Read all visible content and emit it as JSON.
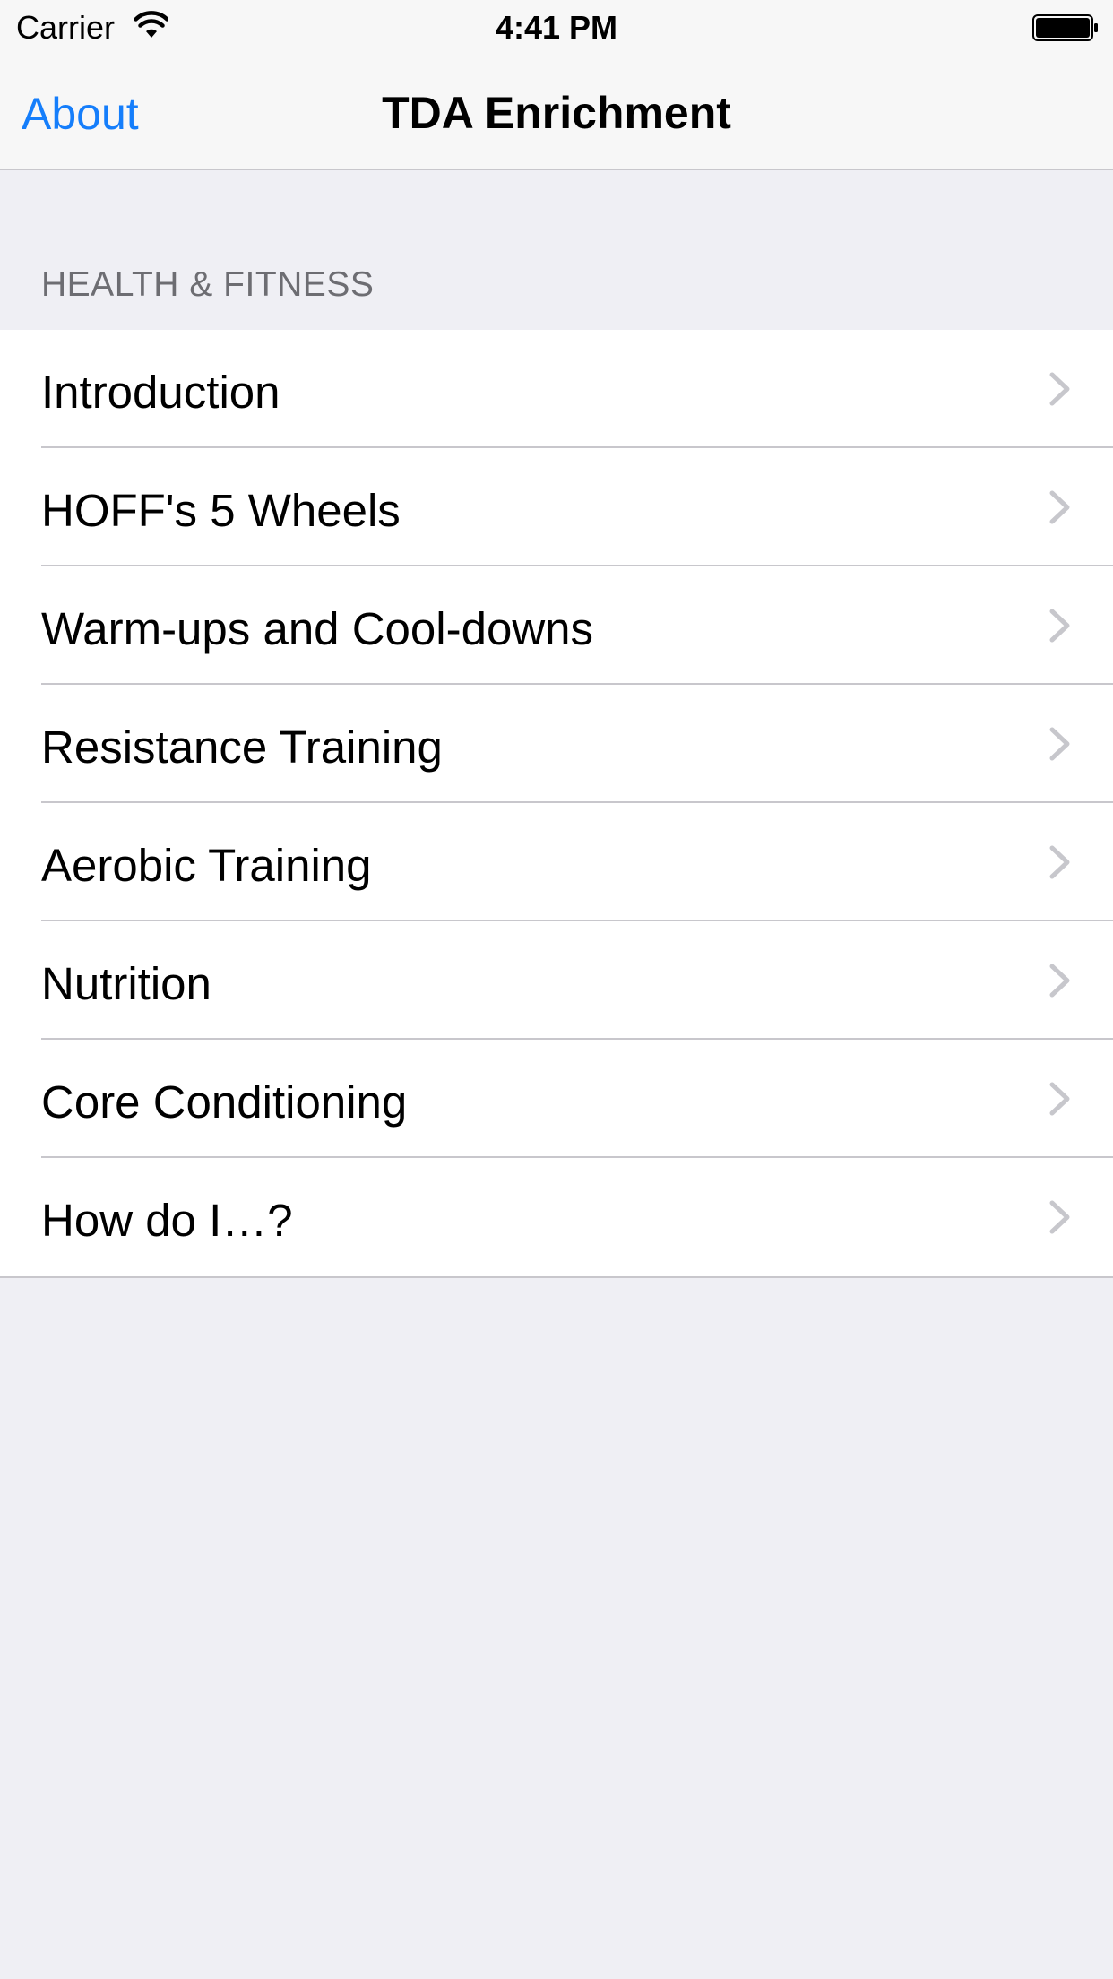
{
  "status_bar": {
    "carrier": "Carrier",
    "time": "4:41 PM"
  },
  "nav": {
    "left_button": "About",
    "title": "TDA Enrichment"
  },
  "section": {
    "header": "HEALTH & FITNESS",
    "items": [
      {
        "label": "Introduction"
      },
      {
        "label": "HOFF's 5 Wheels"
      },
      {
        "label": "Warm-ups and Cool-downs"
      },
      {
        "label": "Resistance Training"
      },
      {
        "label": "Aerobic Training"
      },
      {
        "label": "Nutrition"
      },
      {
        "label": "Core Conditioning"
      },
      {
        "label": "How do I…?"
      }
    ]
  },
  "colors": {
    "accent": "#157efb",
    "background": "#efeff4",
    "separator": "#c8c7cc",
    "section_header_text": "#6d6d72",
    "chevron": "#c7c7cc"
  },
  "icons": {
    "status": [
      "wifi-icon",
      "battery-icon"
    ],
    "row_accessory": "chevron-right-icon"
  }
}
